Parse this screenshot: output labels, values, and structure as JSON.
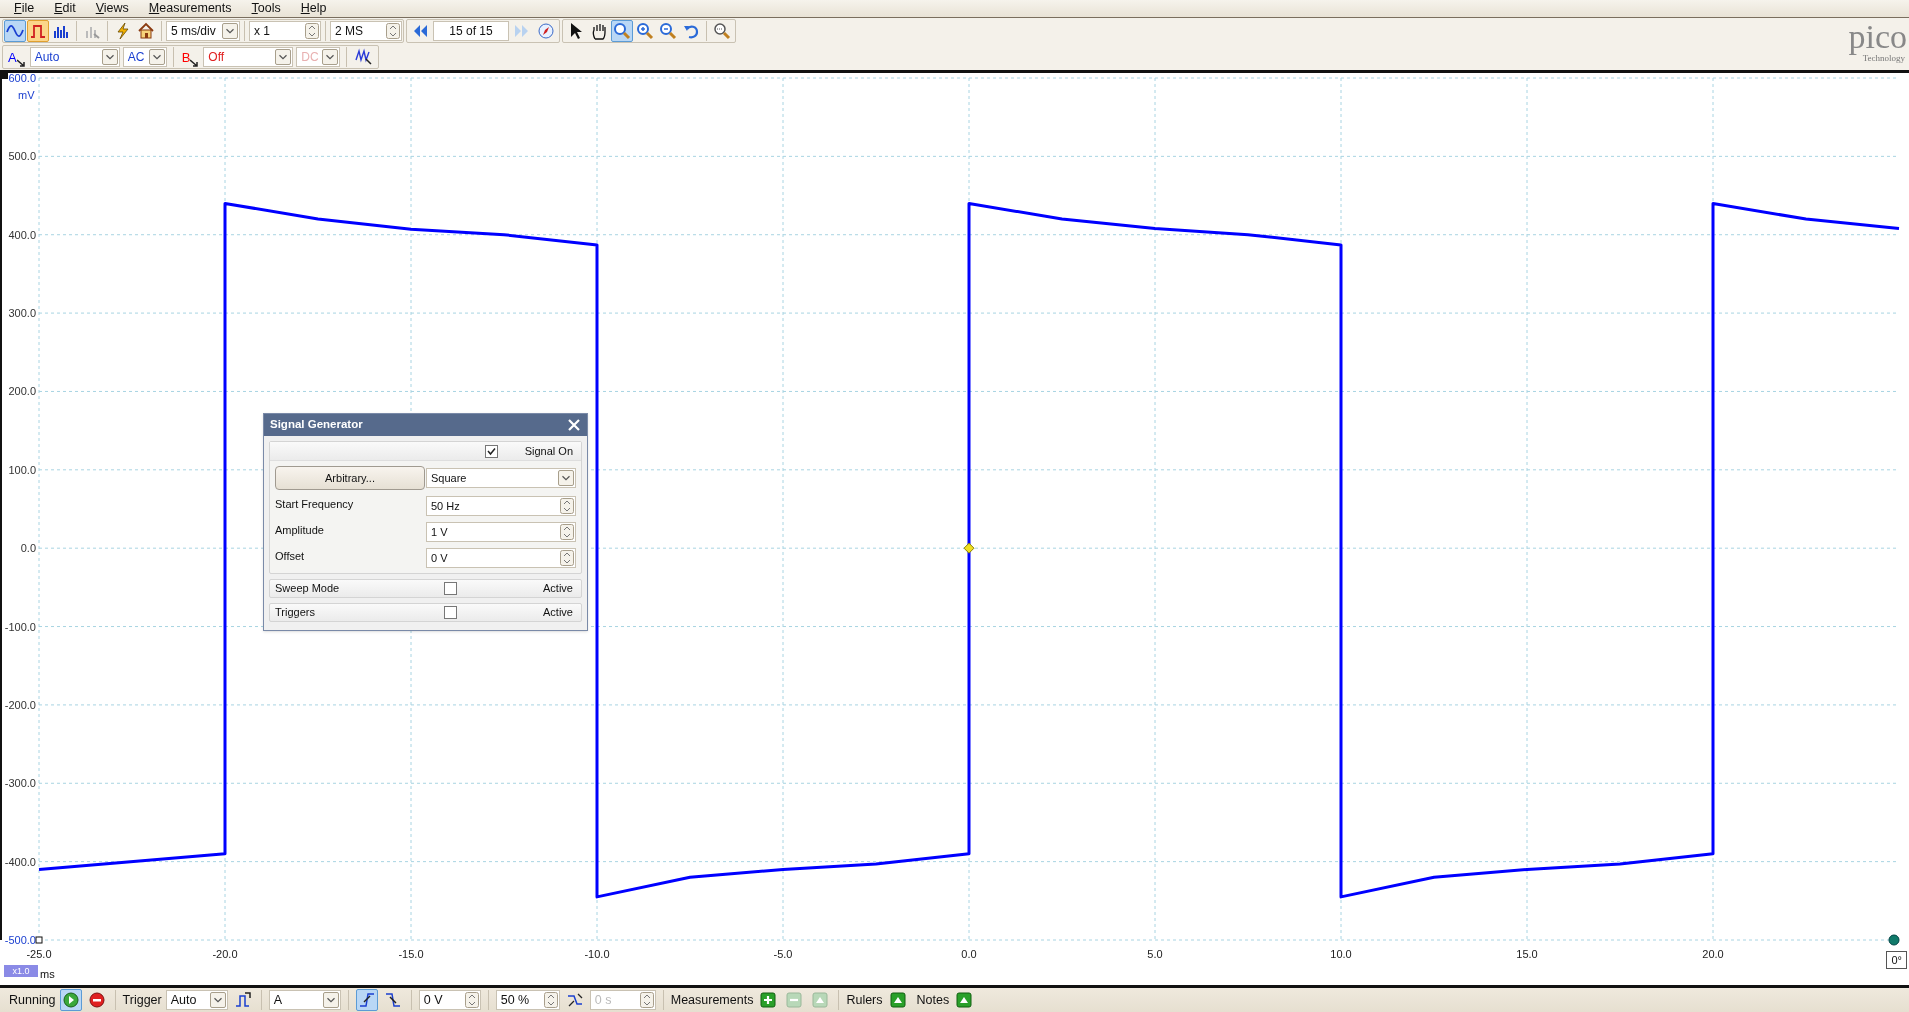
{
  "menu": [
    "File",
    "Edit",
    "Views",
    "Measurements",
    "Tools",
    "Help"
  ],
  "toolbar": {
    "modes": [
      {
        "kind": "scope",
        "selected": true,
        "highlighted": false
      },
      {
        "kind": "persistence",
        "selected": false,
        "highlighted": true
      },
      {
        "kind": "spectrum",
        "selected": false,
        "highlighted": false
      }
    ],
    "timebase": "5 ms/div",
    "zoom_factor": "x 1",
    "samples": "2 MS",
    "buffer": "15 of 15",
    "next_disabled": true,
    "tools": [
      {
        "kind": "pointer",
        "selected": false
      },
      {
        "kind": "hand",
        "selected": false
      },
      {
        "kind": "zoom",
        "selected": true
      },
      {
        "kind": "zoom-in",
        "selected": false
      },
      {
        "kind": "zoom-out",
        "selected": false
      },
      {
        "kind": "undo",
        "selected": false
      }
    ]
  },
  "channels": [
    {
      "name": "A",
      "color": "#0000ff",
      "range": "Auto",
      "coupling": "AC",
      "coupling_disabled": false
    },
    {
      "name": "B",
      "color": "#ff0000",
      "range": "Off",
      "coupling": "DC",
      "coupling_disabled": true
    }
  ],
  "logo": {
    "name": "pico",
    "tagline": "Technology"
  },
  "scope": {
    "zoom_badge": "x1.0",
    "phase": "0°",
    "chart_data": {
      "type": "line",
      "grid": true,
      "xlabel": "ms",
      "ylabel": "mV",
      "xlim": [
        -25,
        25
      ],
      "ylim": [
        -500,
        600
      ],
      "x": [
        -25,
        -20,
        -20,
        -17.5,
        -15,
        -12.5,
        -10,
        -10,
        -7.5,
        -5,
        -2.5,
        0,
        0,
        2.5,
        5,
        7.5,
        10,
        10,
        12.5,
        15,
        17.5,
        20,
        20,
        22.5,
        25
      ],
      "series": [
        {
          "color": "#0000ff",
          "values": [
            -410,
            -390,
            440,
            420,
            407,
            400,
            387,
            -445,
            -420,
            -410,
            -403,
            -390,
            440,
            420,
            408,
            400,
            387,
            -445,
            -420,
            -410,
            -403,
            -390,
            440,
            420,
            408
          ]
        }
      ],
      "xticks": [
        {
          "value": -25,
          "label": "-25.0"
        },
        {
          "value": -20,
          "label": "-20.0"
        },
        {
          "value": -15,
          "label": "-15.0"
        },
        {
          "value": -10,
          "label": "-10.0"
        },
        {
          "value": -5,
          "label": "-5.0"
        },
        {
          "value": 0,
          "label": "0.0"
        },
        {
          "value": 5,
          "label": "5.0"
        },
        {
          "value": 10,
          "label": "10.0"
        },
        {
          "value": 15,
          "label": "15.0"
        },
        {
          "value": 20,
          "label": "20.0"
        }
      ],
      "yticks": [
        {
          "value": 600,
          "label": "600.0"
        },
        {
          "value": 500,
          "label": "500.0"
        },
        {
          "value": 400,
          "label": "400.0"
        },
        {
          "value": 300,
          "label": "300.0"
        },
        {
          "value": 200,
          "label": "200.0"
        },
        {
          "value": 100,
          "label": "100.0"
        },
        {
          "value": 0,
          "label": "0.0"
        },
        {
          "value": -100,
          "label": "-100.0"
        },
        {
          "value": -200,
          "label": "-200.0"
        },
        {
          "value": -300,
          "label": "-300.0"
        },
        {
          "value": -400,
          "label": "-400.0"
        },
        {
          "value": -500,
          "label": "-500.0"
        }
      ]
    }
  },
  "signal_generator": {
    "title": "Signal Generator",
    "signal_on": {
      "label": "Signal On",
      "checked": true
    },
    "arbitrary_button": "Arbitrary...",
    "waveform": "Square",
    "fields": [
      {
        "label": "Start Frequency",
        "value": "50 Hz"
      },
      {
        "label": "Amplitude",
        "value": "1 V"
      },
      {
        "label": "Offset",
        "value": "0 V"
      }
    ],
    "sections": [
      {
        "label": "Sweep Mode",
        "active_label": "Active",
        "checked": false
      },
      {
        "label": "Triggers",
        "active_label": "Active",
        "checked": false
      }
    ]
  },
  "status_bar": {
    "run_state": "Running",
    "running": true,
    "trigger_label": "Trigger",
    "trigger_mode": "Auto",
    "trigger_source": "A",
    "edges": [
      {
        "kind": "rising",
        "selected": true
      },
      {
        "kind": "falling",
        "selected": false
      }
    ],
    "threshold": "0 V",
    "pre_trigger": "50 %",
    "delay": "0 s",
    "delay_disabled": true,
    "measurements_label": "Measurements",
    "rulers_label": "Rulers",
    "notes_label": "Notes"
  }
}
